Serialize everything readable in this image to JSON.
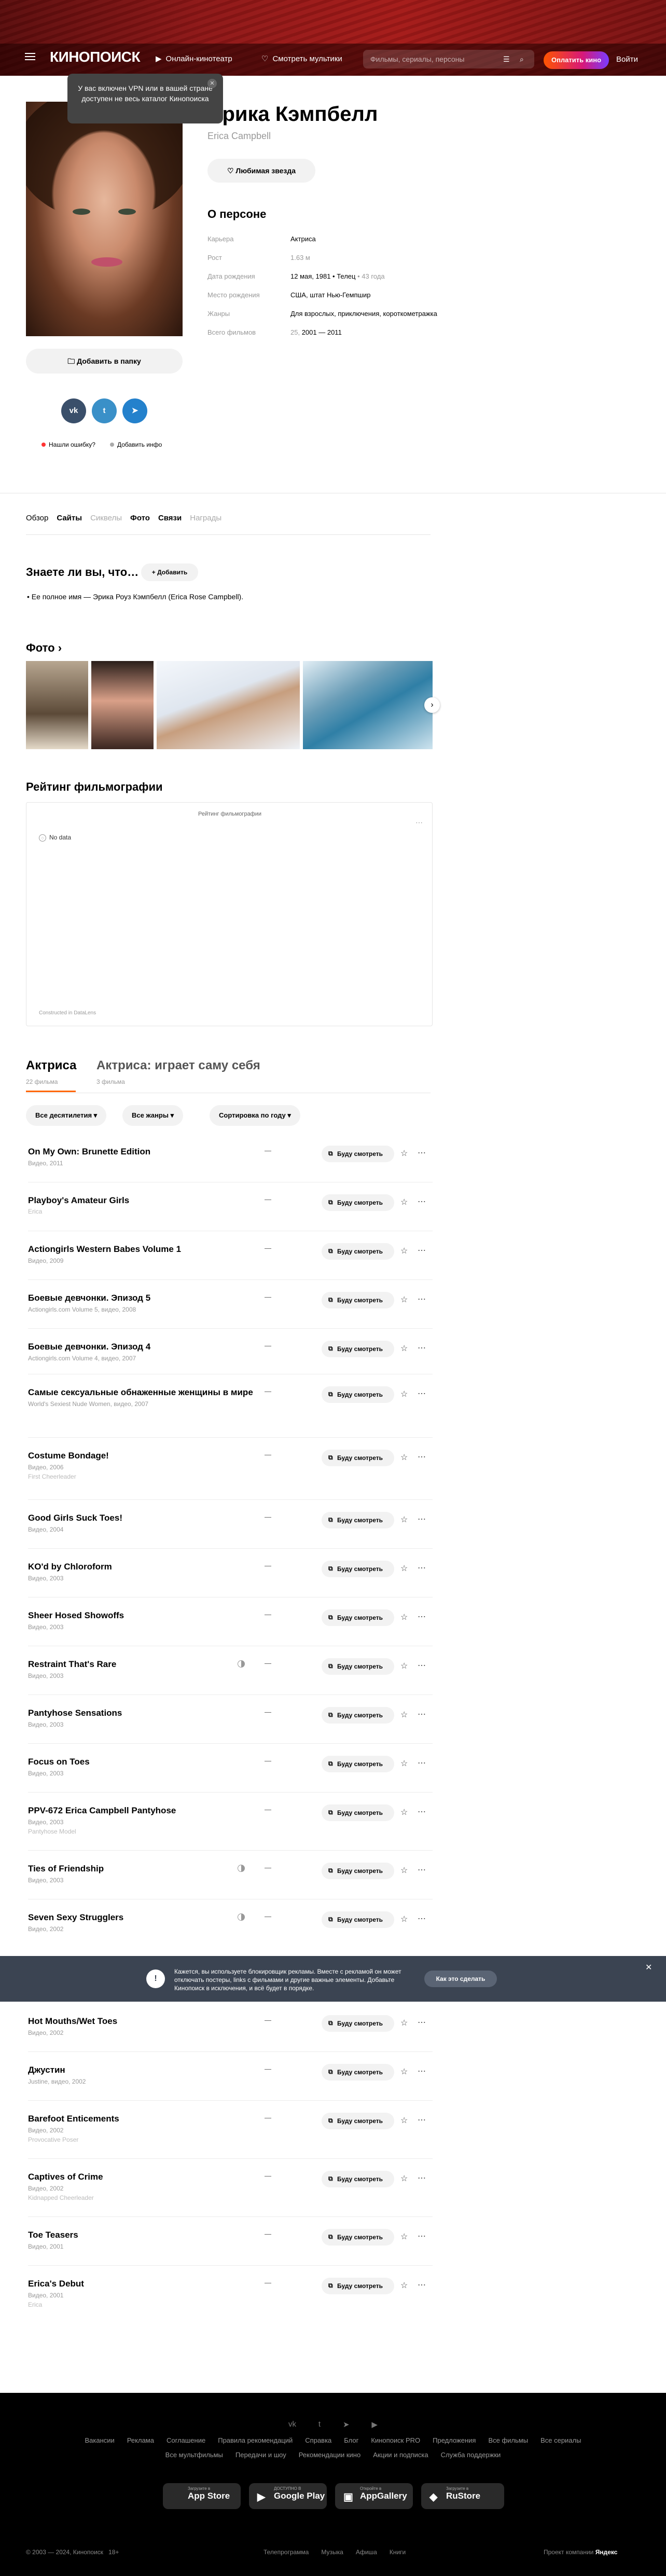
{
  "header": {
    "logo": "КИНОПОИСК",
    "nav": [
      "Онлайн-кинотеатр",
      "Смотреть мультики"
    ],
    "search_placeholder": "Фильмы, сериалы, персоны",
    "cta": "Оплатить кино",
    "login": "Войти"
  },
  "vpn_tooltip": "У вас включен VPN или в вашей стране доступен не весь каталог Кинопоиска",
  "person": {
    "name": "Эрика Кэмпбелл",
    "original_name": "Erica Campbell",
    "fav_button": "Любимая звезда",
    "add_folder": "Добавить в папку",
    "about_title": "О персоне",
    "info": [
      {
        "key": "Карьера",
        "value": "Актриса",
        "extra": ""
      },
      {
        "key": "Рост",
        "value": "1.63 м",
        "extra": ""
      },
      {
        "key": "Дата рождения",
        "value": "12 мая, 1981 • Телец",
        "extra": "• 43 года"
      },
      {
        "key": "Место рождения",
        "value": "США, штат Нью-Гемпшир",
        "extra": ""
      },
      {
        "key": "Жанры",
        "value": "Для взрослых, приключения, короткометражка",
        "extra": ""
      },
      {
        "key": "Всего фильмов",
        "value": "2001 — 2011",
        "extra": "25,"
      }
    ],
    "social": [
      "vk",
      "tw",
      "tg"
    ],
    "found_error": "Нашли ошибку?",
    "add_info": "Добавить инфо"
  },
  "tabs": [
    "Обзор",
    "Сайты",
    "Сиквелы",
    "Фото",
    "Связи",
    "Награды"
  ],
  "trivia": {
    "title": "Знаете ли вы, что…",
    "add_button": "Добавить",
    "item": "Ее полное имя — Эрика Роуз Кэмпбелл (Erica Rose Campbell)."
  },
  "photos": {
    "title": "Фото"
  },
  "rating": {
    "title": "Рейтинг фильмографии",
    "chart_title": "Рейтинг фильмографии",
    "no_data": "No data",
    "credit": "Constructed in DataLens"
  },
  "filmography": {
    "tab1": "Актриса",
    "tab1_count": "22 фильма",
    "tab2": "Актриса: играет саму себя",
    "tab2_count": "3 фильма",
    "filters": [
      "Все десятилетия",
      "Все жанры",
      "Сортировка по году"
    ],
    "will_watch": "Буду смотреть",
    "rating_placeholder": "—",
    "films": [
      {
        "title": "On My Own: Brunette Edition",
        "sub": "Видео, 2011",
        "role": "",
        "half": false
      },
      {
        "title": "Playboy's Amateur Girls",
        "sub": "",
        "role": "Erica",
        "half": false
      },
      {
        "title": "Actiongirls Western Babes Volume 1",
        "sub": "Видео, 2009",
        "role": "",
        "half": false
      },
      {
        "title": "Боевые девчонки. Эпизод 5",
        "sub": "Actiongirls.com Volume 5, видео, 2008",
        "role": "",
        "half": false
      },
      {
        "title": "Боевые девчонки. Эпизод 4",
        "sub": "Actiongirls.com Volume 4, видео, 2007",
        "role": "",
        "half": false
      },
      {
        "title": "Самые сексуальные обнаженные женщины в мире",
        "sub": "World's Sexiest Nude Women, видео, 2007",
        "role": "",
        "half": false
      },
      {
        "title": "Costume Bondage!",
        "sub": "Видео, 2006",
        "role": "First Cheerleader",
        "half": false
      },
      {
        "title": "Good Girls Suck Toes!",
        "sub": "Видео, 2004",
        "role": "",
        "half": false
      },
      {
        "title": "KO'd by Chloroform",
        "sub": "Видео, 2003",
        "role": "",
        "half": false
      },
      {
        "title": "Sheer Hosed Showoffs",
        "sub": "Видео, 2003",
        "role": "",
        "half": false
      },
      {
        "title": "Restraint That's Rare",
        "sub": "Видео, 2003",
        "role": "",
        "half": true
      },
      {
        "title": "Pantyhose Sensations",
        "sub": "Видео, 2003",
        "role": "",
        "half": false
      },
      {
        "title": "Focus on Toes",
        "sub": "Видео, 2003",
        "role": "",
        "half": false
      },
      {
        "title": "PPV-672 Erica Campbell Pantyhose",
        "sub": "Видео, 2003",
        "role": "Pantyhose Model",
        "half": false
      },
      {
        "title": "Ties of Friendship",
        "sub": "Видео, 2003",
        "role": "",
        "half": true
      },
      {
        "title": "Seven Sexy Strugglers",
        "sub": "Видео, 2002",
        "role": "",
        "half": true
      },
      {
        "title": "Hot Mouths/Wet Toes",
        "sub": "Видео, 2002",
        "role": "",
        "half": false
      },
      {
        "title": "Джустин",
        "sub": "Justine, видео, 2002",
        "role": "",
        "half": false
      },
      {
        "title": "Barefoot Enticements",
        "sub": "Видео, 2002",
        "role": "Provocative Poser",
        "half": false
      },
      {
        "title": "Captives of Crime",
        "sub": "Видео, 2002",
        "role": "Kidnapped Cheerleader",
        "half": false
      },
      {
        "title": "Toe Teasers",
        "sub": "Видео, 2001",
        "role": "",
        "half": false
      },
      {
        "title": "Erica's Debut",
        "sub": "Видео, 2001",
        "role": "Erica",
        "half": false
      }
    ]
  },
  "adblock": {
    "text": "Кажется, вы используете блокировщик рекламы. Вместе с рекламой он может отключать постеры, links с фильмами и другие важные элементы. Добавьте Кинопоиск в исключения, и всё будет в порядке.",
    "button": "Как это сделать"
  },
  "footer": {
    "social": [
      "vk",
      "tw",
      "tg",
      "yt"
    ],
    "links1": [
      "Вакансии",
      "Реклама",
      "Соглашение",
      "Правила рекомендаций",
      "Справка",
      "Блог",
      "Кинопоиск PRO",
      "Предложения",
      "Все фильмы",
      "Все сериалы"
    ],
    "links2": [
      "Все мультфильмы",
      "Передачи и шоу",
      "Рекомендации кино",
      "Акции и подписка",
      "Служба поддержки"
    ],
    "stores": [
      {
        "small": "Загрузите в",
        "name": "App Store"
      },
      {
        "small": "ДОСТУПНО В",
        "name": "Google Play"
      },
      {
        "small": "Откройте в",
        "name": "AppGallery"
      },
      {
        "small": "Загрузите в",
        "name": "RuStore"
      }
    ],
    "copyright": "© 2003 — 2024, Кинопоиск",
    "age": "18+",
    "bottom_links": [
      "Телепрограмма",
      "Музыка",
      "Афиша",
      "Книги"
    ],
    "project": "Проект компании",
    "company": "Яндекс"
  },
  "colors": {
    "accent": "#ff6600",
    "header_red": "#a51a18",
    "adblock_bg": "#3b4452",
    "footer_bg": "#000000"
  }
}
